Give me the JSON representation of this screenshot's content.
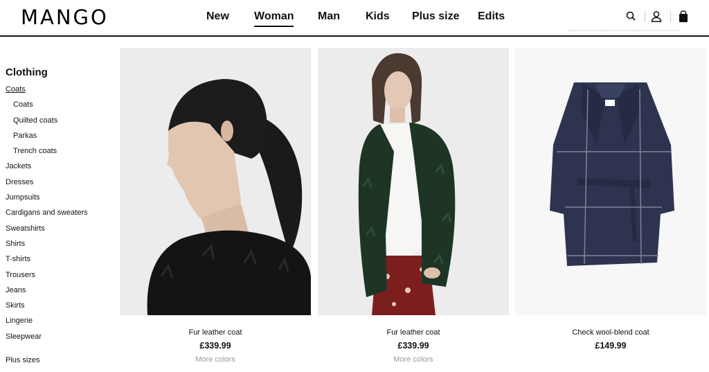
{
  "brand": {
    "logo_text": "MANGO"
  },
  "nav": {
    "items": [
      {
        "label": "New"
      },
      {
        "label": "Woman"
      },
      {
        "label": "Man"
      },
      {
        "label": "Kids"
      },
      {
        "label": "Plus size"
      },
      {
        "label": "Edits"
      }
    ],
    "active": "Woman"
  },
  "header_icons": [
    "search-icon",
    "user-icon",
    "shopping-bag-icon"
  ],
  "sidebar": {
    "heading": "Clothing",
    "items": [
      {
        "label": "Coats",
        "level": 0,
        "selected": true
      },
      {
        "label": "Coats",
        "level": 1
      },
      {
        "label": "Quilted coats",
        "level": 1
      },
      {
        "label": "Parkas",
        "level": 1
      },
      {
        "label": "Trench coats",
        "level": 1
      },
      {
        "label": "Jackets",
        "level": 0
      },
      {
        "label": "Dresses",
        "level": 0
      },
      {
        "label": "Jumpsuits",
        "level": 0
      },
      {
        "label": "Cardigans and sweaters",
        "level": 0
      },
      {
        "label": "Sweatshirts",
        "level": 0
      },
      {
        "label": "Shirts",
        "level": 0
      },
      {
        "label": "T-shirts",
        "level": 0
      },
      {
        "label": "Trousers",
        "level": 0
      },
      {
        "label": "Jeans",
        "level": 0
      },
      {
        "label": "Skirts",
        "level": 0
      },
      {
        "label": "Lingerie",
        "level": 0
      },
      {
        "label": "Sleepwear",
        "level": 0
      }
    ],
    "footer_item": "Plus sizes"
  },
  "products": [
    {
      "name": "Fur leather coat",
      "price": "£339.99",
      "more": "More colors"
    },
    {
      "name": "Fur leather coat",
      "price": "£339.99",
      "more": "More colors"
    },
    {
      "name": "Check wool-blend coat",
      "price": "£149.99"
    }
  ],
  "colors": {
    "text": "#111111",
    "muted": "#999999",
    "image_bg": "#e9e9ea",
    "coat_navy": "#2e3450",
    "coat_green": "#1f3327",
    "coat_black": "#151515"
  }
}
